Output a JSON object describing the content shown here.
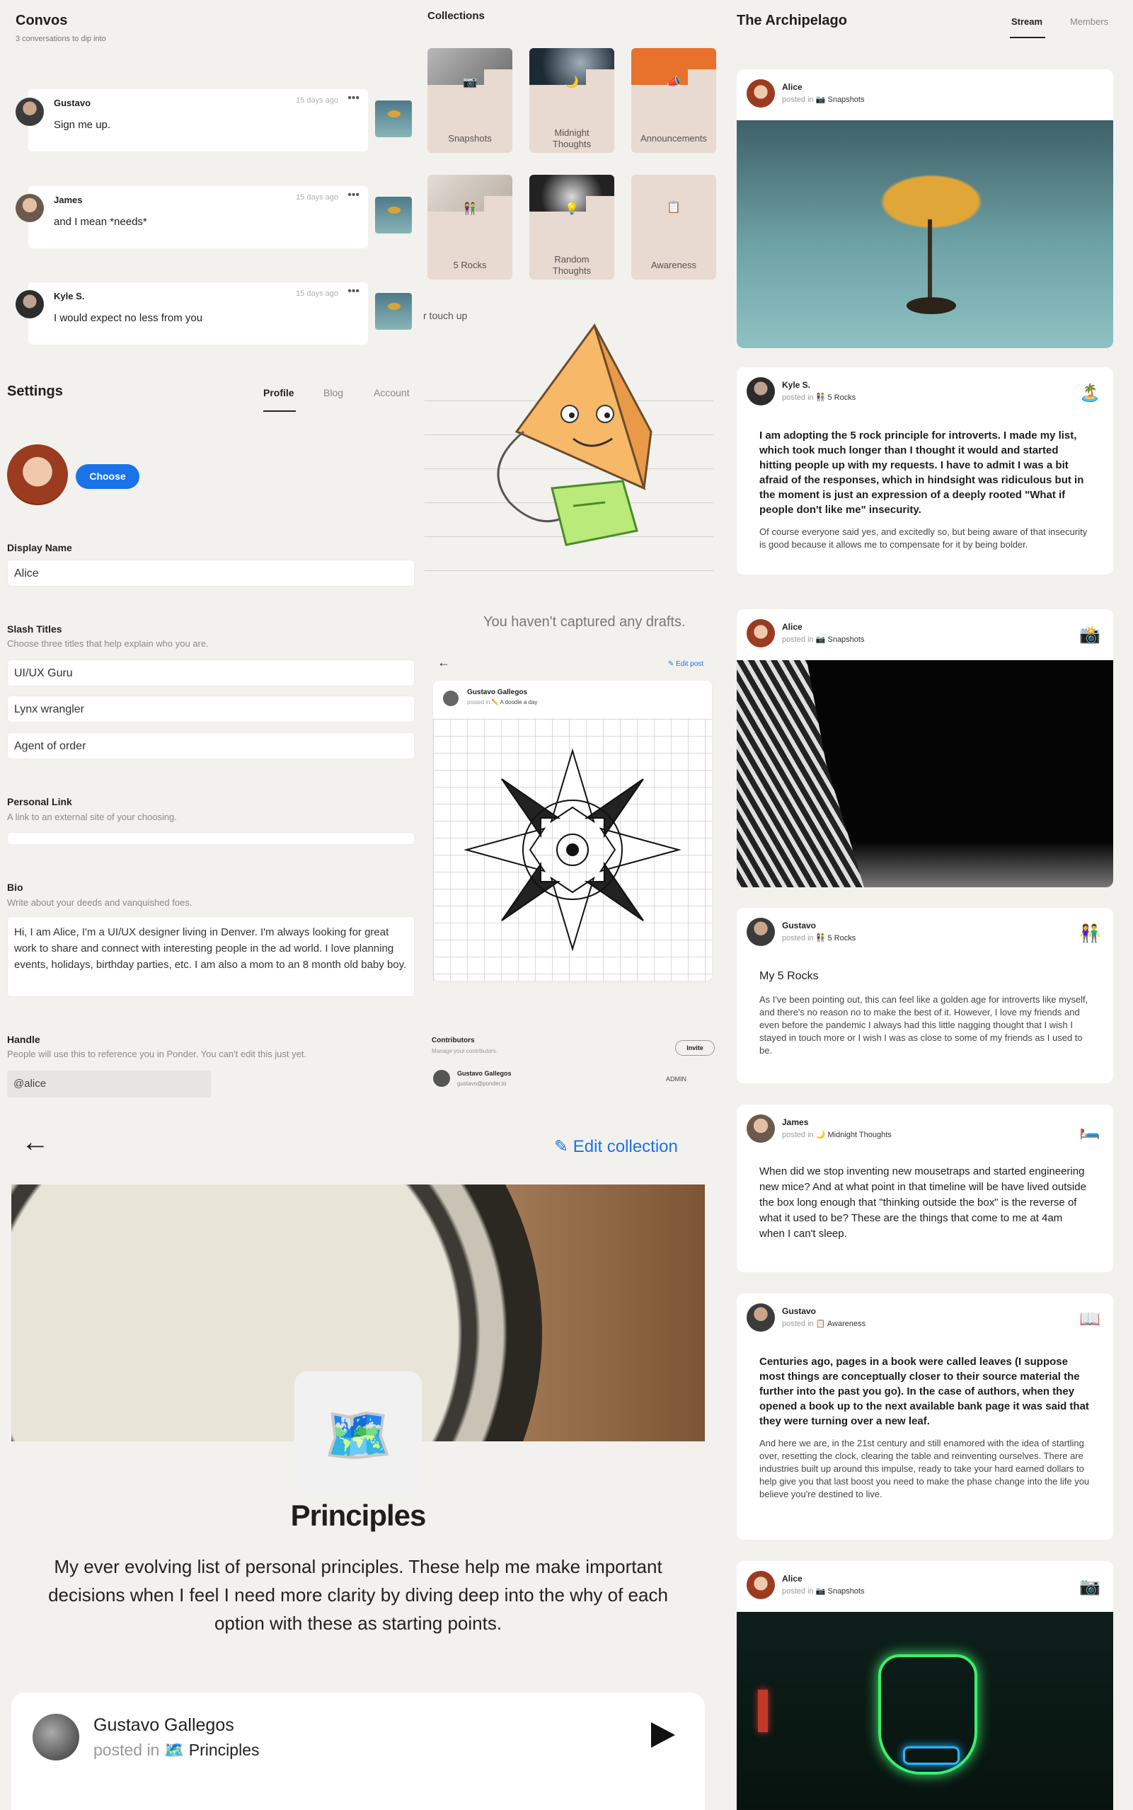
{
  "convos": {
    "title": "Convos",
    "subtitle": "3 conversations to dip into",
    "items": [
      {
        "name": "Gustavo",
        "time": "15 days ago",
        "message": "Sign me up."
      },
      {
        "name": "James",
        "time": "15 days ago",
        "message": "and I mean *needs*"
      },
      {
        "name": "Kyle S.",
        "time": "15 days ago",
        "message": "I would expect no less from you"
      }
    ],
    "more_icon": "more-horizontal-icon"
  },
  "collections": {
    "title": "Collections",
    "items": [
      {
        "label": "Snapshots",
        "icon": "camera-icon",
        "glyph": "📷"
      },
      {
        "label": "Midnight Thoughts",
        "icon": "moon-icon",
        "glyph": "🌙"
      },
      {
        "label": "Announcements",
        "icon": "megaphone-icon",
        "glyph": "📣"
      },
      {
        "label": "5 Rocks",
        "icon": "people-icon",
        "glyph": "👫"
      },
      {
        "label": "Random Thoughts",
        "icon": "lightbulb-icon",
        "glyph": "💡"
      },
      {
        "label": "Awareness",
        "icon": "notebook-icon",
        "glyph": "📋"
      }
    ]
  },
  "drafts": {
    "touch_up": "r touch up",
    "empty": "You haven't captured any drafts."
  },
  "settings": {
    "title": "Settings",
    "tabs": [
      "Profile",
      "Blog",
      "Account"
    ],
    "active_tab": "Profile",
    "choose_label": "Choose",
    "display_name_label": "Display Name",
    "display_name": "Alice",
    "slash_titles_label": "Slash Titles",
    "slash_titles_hint": "Choose three titles that help explain who you are.",
    "slash_titles": [
      "UI/UX Guru",
      "Lynx wrangler",
      "Agent of order"
    ],
    "personal_link_label": "Personal Link",
    "personal_link_hint": "A link to an external site of your choosing.",
    "bio_label": "Bio",
    "bio_hint": "Write about your deeds and vanquished foes.",
    "bio": "Hi, I am Alice, I'm a UI/UX designer living in Denver. I'm always looking for great work to share and connect with interesting people in the ad world. I love planning events, holidays, birthday parties, etc. I am also a mom to an 8 month old baby boy.",
    "handle_label": "Handle",
    "handle_hint": "People will use this to reference you in Ponder. You can't edit this just yet.",
    "handle": "@alice"
  },
  "post_editor": {
    "edit_label": "Edit post",
    "author": "Gustavo Gallegos",
    "posted_in_prefix": "posted in",
    "collection": "A doodle a day",
    "collection_glyph": "✏️",
    "contributors_label": "Contributors",
    "contributors_hint": "Manage your contributors.",
    "invite_label": "Invite",
    "contributor_name": "Gustavo Gallegos",
    "contributor_email": "gustavo@ponder.to",
    "contributor_role": "ADMIN"
  },
  "collection_page": {
    "edit_label": "Edit collection",
    "icon": "world-map-icon",
    "glyph": "🗺️",
    "title": "Principles",
    "description": "My ever evolving list of personal principles. These help me make important decisions when I feel I need more clarity by diving deep into the why of each option with these as starting points.",
    "post_author": "Gustavo Gallegos",
    "posted_in": "posted in",
    "post_collection_glyph": "🗺️",
    "post_collection": "Principles"
  },
  "stream": {
    "title": "The Archipelago",
    "tabs": [
      "Stream",
      "Members"
    ],
    "active_tab": "Stream",
    "posted_in": "posted in",
    "posts": [
      {
        "author": "Alice",
        "collection_glyph": "📷",
        "collection": "Snapshots",
        "emoji": ""
      },
      {
        "author": "Kyle S.",
        "collection_glyph": "👫",
        "collection": "5 Rocks",
        "emoji": "🏝️",
        "text": "I am adopting the 5 rock principle for introverts. I made my list, which took much longer than I thought it would and started hitting people up with my requests. I have to admit I was a bit afraid of the responses, which in hindsight was ridiculous but in the moment is just an expression of a deeply rooted \"What if people don't like me\" insecurity.",
        "text2": "Of course everyone said yes, and excitedly so, but being aware of that insecurity is good because it allows me to compensate for it by being bolder."
      },
      {
        "author": "Alice",
        "collection_glyph": "📷",
        "collection": "Snapshots",
        "emoji": "📸"
      },
      {
        "author": "Gustavo",
        "collection_glyph": "👫",
        "collection": "5 Rocks",
        "emoji": "👫",
        "heading": "My 5 Rocks",
        "text": "As I've been pointing out, this can feel like a golden age for introverts like myself, and there's no reason no to make the best of it. However, I love my friends and even before the pandemic I always had this little nagging thought that I wish I stayed in touch more or I wish I was as close to some of my friends as I used to be."
      },
      {
        "author": "James",
        "collection_glyph": "🌙",
        "collection": "Midnight Thoughts",
        "emoji": "🛏️",
        "text": "When did we stop inventing new mousetraps and started engineering new mice? And at what point in that timeline will be have lived outside the box long enough that \"thinking outside the box\" is the reverse of what it used to be? These are the things that come to me at 4am when I can't sleep."
      },
      {
        "author": "Gustavo",
        "collection_glyph": "📋",
        "collection": "Awareness",
        "emoji": "📖",
        "text": "Centuries ago, pages in a book were called leaves (I suppose most things are conceptually closer to their source material the further into the past you go). In the case of authors, when they opened a book up to the next available bank page it was said that they were turning over a new leaf.",
        "text2": "And here we are, in the 21st century and still enamored with the idea of startling over, resetting the clock, clearing the table and reinventing ourselves. There are industries built up around this impulse, ready to take your hard earned dollars to help give you that last boost you need to make the phase change into the life you believe you're destined to live."
      },
      {
        "author": "Alice",
        "collection_glyph": "📷",
        "collection": "Snapshots",
        "emoji": "📷"
      }
    ]
  },
  "colors": {
    "accent": "#1a73e8",
    "background": "#f2f1ee",
    "collection_card": "#e8d9d1"
  }
}
